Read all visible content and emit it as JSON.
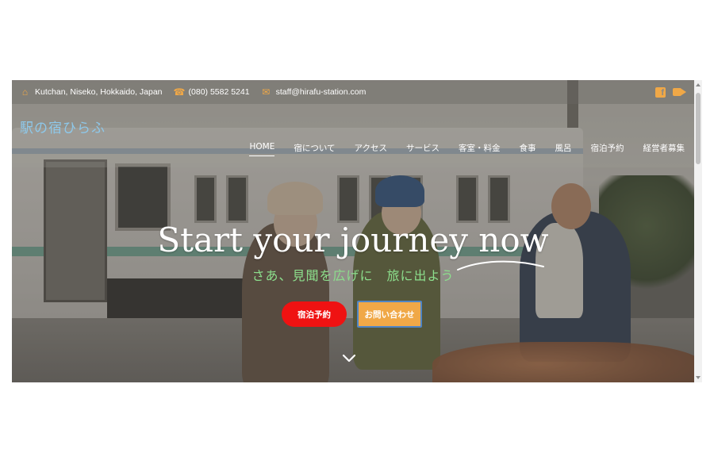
{
  "topbar": {
    "address": "Kutchan, Niseko, Hokkaido, Japan",
    "phone": "(080) 5582 5241",
    "email": "staff@hirafu-station.com",
    "icons": [
      "home-icon",
      "phone-icon",
      "envelope-icon",
      "facebook-icon",
      "video-camera-icon"
    ]
  },
  "header": {
    "logo": "駅の宿ひらふ"
  },
  "nav": {
    "items": [
      "HOME",
      "宿について",
      "アクセス",
      "サービス",
      "客室・料金",
      "食事",
      "風呂",
      "宿泊予約",
      "経営者募集"
    ],
    "active": "HOME"
  },
  "hero": {
    "title": "Start your journey now",
    "subtitle": "さあ、見聞を広げに　旅に出よう",
    "book_button": "宿泊予約",
    "contact_button": "お問い合わせ"
  },
  "colors": {
    "accent": "#f0a847",
    "logo": "#8ec8ea",
    "subtitle": "#8cde8c",
    "book_button": "#ef1212",
    "contact_border": "#4f86c6"
  }
}
